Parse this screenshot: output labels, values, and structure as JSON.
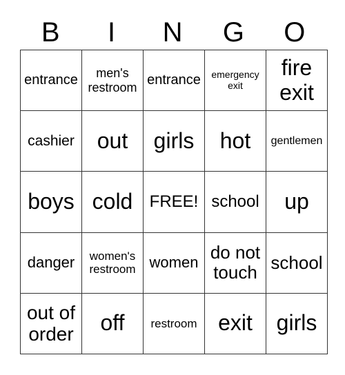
{
  "header": {
    "letters": [
      "B",
      "I",
      "N",
      "G",
      "O"
    ]
  },
  "rows": [
    [
      "entrance",
      "men's restroom",
      "entrance",
      "emergency exit",
      "fire exit"
    ],
    [
      "cashier",
      "out",
      "girls",
      "hot",
      "gentlemen"
    ],
    [
      "boys",
      "cold",
      "FREE!",
      "school",
      "up"
    ],
    [
      "danger",
      "women's restroom",
      "women",
      "do not touch",
      "school"
    ],
    [
      "out of order",
      "off",
      "restroom",
      "exit",
      "girls"
    ]
  ]
}
